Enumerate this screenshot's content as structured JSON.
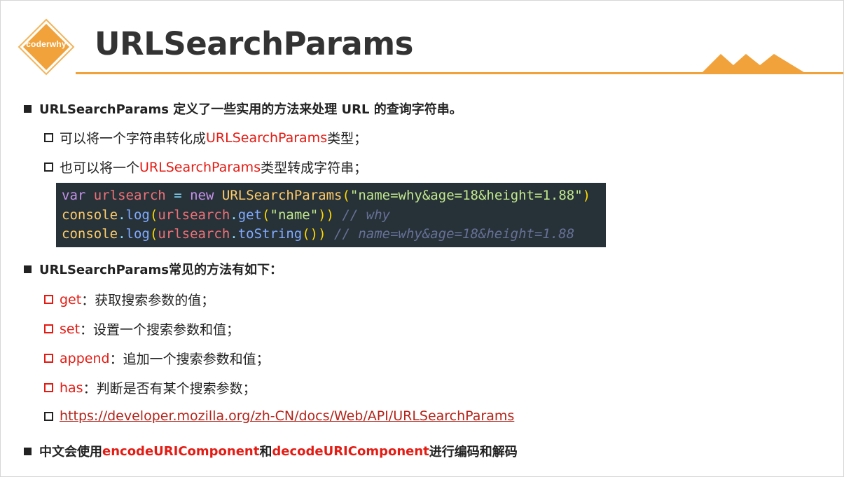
{
  "logo": {
    "text": "coderwhy"
  },
  "title": "URLSearchParams",
  "colors": {
    "accent": "#f1a23a",
    "red": "#e41b13",
    "code_bg": "#263238"
  },
  "bullets": {
    "b1": {
      "text": "URLSearchParams 定义了一些实用的方法来处理 URL 的查询字符串。"
    },
    "b1_1": {
      "pre": "可以将一个字符串转化成",
      "hl": "URLSearchParams",
      "post": "类型；"
    },
    "b1_2": {
      "pre": "也可以将一个",
      "hl": "URLSearchParams",
      "post": "类型转成字符串；"
    },
    "b2": {
      "text": "URLSearchParams常见的方法有如下："
    },
    "methods": [
      {
        "name": "get",
        "desc": "：获取搜索参数的值；"
      },
      {
        "name": "set",
        "desc": "：设置一个搜索参数和值；"
      },
      {
        "name": "append",
        "desc": "：追加一个搜索参数和值；"
      },
      {
        "name": "has",
        "desc": "：判断是否有某个搜索参数；"
      }
    ],
    "link": "https://developer.mozilla.org/zh-CN/docs/Web/API/URLSearchParams",
    "b3": {
      "pre": "中文会使用",
      "hl1": "encodeURIComponent",
      "mid": "和",
      "hl2": "decodeURIComponent",
      "post": "进行编码和解码"
    }
  },
  "code": {
    "l1": {
      "kw": "var",
      "v": "urlsearch",
      "op": "=",
      "kw2": "new",
      "cls": "URLSearchParams",
      "p1": "(",
      "str": "\"name=why&age=18&height=1.88\"",
      "p2": ")"
    },
    "l2": {
      "obj": "console",
      "d": ".",
      "fn": "log",
      "p1": "(",
      "v": "urlsearch",
      "d2": ".",
      "fn2": "get",
      "p2": "(",
      "str": "\"name\"",
      "p3": "))",
      "cm": "// why"
    },
    "l3": {
      "obj": "console",
      "d": ".",
      "fn": "log",
      "p1": "(",
      "v": "urlsearch",
      "d2": ".",
      "fn2": "toString",
      "p2": "())",
      "cm": "// name=why&age=18&height=1.88"
    }
  }
}
